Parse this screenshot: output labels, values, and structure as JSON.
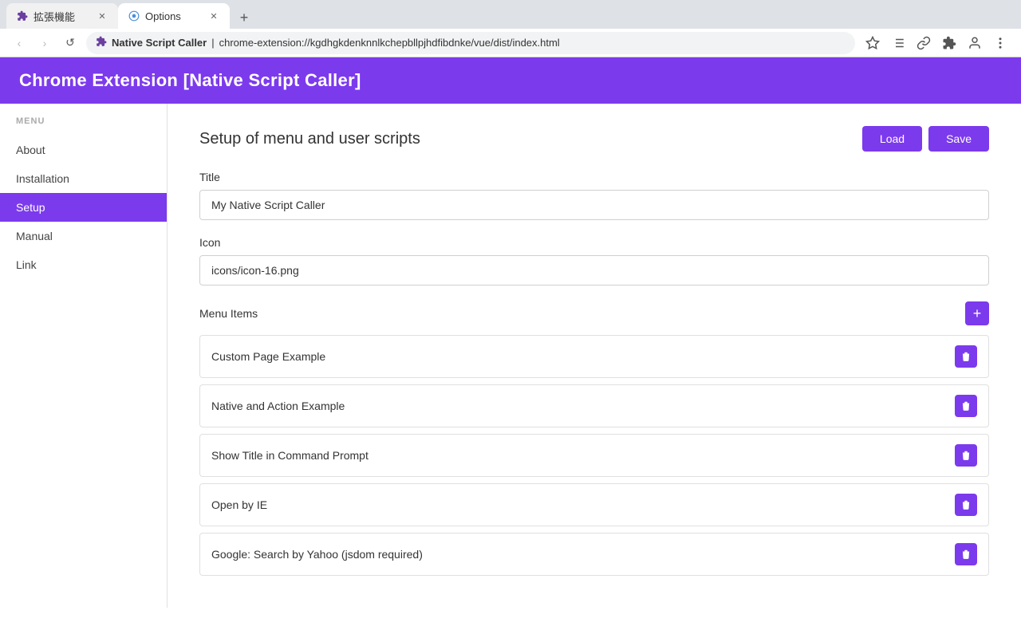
{
  "browser": {
    "tabs": [
      {
        "id": "tab1",
        "title": "拡張機能",
        "icon": "puzzle",
        "active": false,
        "closable": true
      },
      {
        "id": "tab2",
        "title": "Options",
        "icon": "settings",
        "active": true,
        "closable": true
      }
    ],
    "new_tab_label": "+",
    "address": {
      "icon_label": "★",
      "site_name": "Native Script Caller",
      "separator": "|",
      "url": "chrome-extension://kgdhgkdenknnlkchepbllpjhdfibdnke/vue/dist/index.html"
    },
    "nav": {
      "back": "‹",
      "forward": "›",
      "reload": "↺",
      "home": "⌂"
    },
    "toolbar": {
      "bookmark": "★",
      "list": "☰",
      "link": "🔗",
      "puzzle": "🧩",
      "account": "👤",
      "menu": "⋮"
    }
  },
  "page_header": {
    "title": "Chrome Extension [Native Script Caller]"
  },
  "sidebar": {
    "menu_label": "MENU",
    "items": [
      {
        "id": "about",
        "label": "About",
        "active": false
      },
      {
        "id": "installation",
        "label": "Installation",
        "active": false
      },
      {
        "id": "setup",
        "label": "Setup",
        "active": true
      },
      {
        "id": "manual",
        "label": "Manual",
        "active": false
      },
      {
        "id": "link",
        "label": "Link",
        "active": false
      }
    ]
  },
  "main_panel": {
    "section_title": "Setup of menu and user scripts",
    "load_button": "Load",
    "save_button": "Save",
    "title_label": "Title",
    "title_value": "My Native Script Caller",
    "title_placeholder": "My Native Script Caller",
    "icon_label": "Icon",
    "icon_value": "icons/icon-16.png",
    "icon_placeholder": "icons/icon-16.png",
    "menu_items_label": "Menu Items",
    "add_button": "+",
    "menu_items": [
      {
        "id": "item1",
        "label": "Custom Page Example"
      },
      {
        "id": "item2",
        "label": "Native and Action Example"
      },
      {
        "id": "item3",
        "label": "Show Title in Command Prompt"
      },
      {
        "id": "item4",
        "label": "Open by IE"
      },
      {
        "id": "item5",
        "label": "Google: Search by Yahoo (jsdom required)"
      }
    ],
    "delete_icon": "🗑"
  },
  "colors": {
    "accent": "#7c3aed",
    "header_bg": "#7c3aed"
  }
}
